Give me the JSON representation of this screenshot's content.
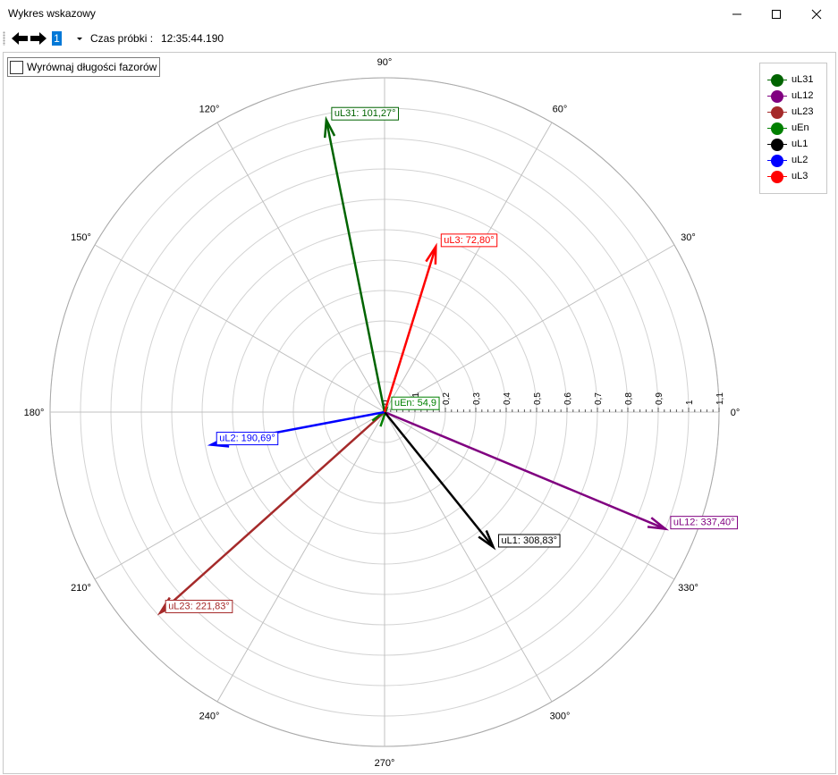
{
  "window": {
    "title": "Wykres wskazowy"
  },
  "toolbar": {
    "sample_number": "1",
    "time_label": "Czas próbki :",
    "time_value": "12:35:44.190"
  },
  "options": {
    "equalize_label": "Wyrównaj długości fazorów",
    "equalize_checked": false
  },
  "chart_data": {
    "type": "polar",
    "angle_labels": [
      "0°",
      "30°",
      "60°",
      "90°",
      "120°",
      "150°",
      "180°",
      "210°",
      "240°",
      "270°",
      "300°",
      "330°"
    ],
    "radial_ticks": [
      "0",
      "0,1",
      "0,2",
      "0,3",
      "0,4",
      "0,5",
      "0,6",
      "0,7",
      "0,8",
      "0,9",
      "1",
      "1,1"
    ],
    "rmax": 1.1,
    "grid": true,
    "legend_position": "top-right",
    "phasors": [
      {
        "name": "uL31",
        "label": "uL31: 101,27°",
        "angle": 101.27,
        "magnitude": 0.98,
        "color": "#006400"
      },
      {
        "name": "uL12",
        "label": "uL12: 337,40°",
        "angle": 337.4,
        "magnitude": 1.0,
        "color": "#800080"
      },
      {
        "name": "uL23",
        "label": "uL23: 221,83°",
        "angle": 221.83,
        "magnitude": 0.99,
        "color": "#a52a2a"
      },
      {
        "name": "uEn",
        "label": "uEn: 54,9",
        "angle": 54.9,
        "magnitude": 0.01,
        "color": "#008000"
      },
      {
        "name": "uL1",
        "label": "uL1: 308,83°",
        "angle": 308.83,
        "magnitude": 0.57,
        "color": "#000000"
      },
      {
        "name": "uL2",
        "label": "uL2: 190,69°",
        "angle": 190.69,
        "magnitude": 0.58,
        "color": "#0000ff"
      },
      {
        "name": "uL3",
        "label": "uL3: 72,80°",
        "angle": 72.8,
        "magnitude": 0.57,
        "color": "#ff0000"
      }
    ],
    "legend": [
      {
        "name": "uL31",
        "color": "#006400"
      },
      {
        "name": "uL12",
        "color": "#800080"
      },
      {
        "name": "uL23",
        "color": "#a52a2a"
      },
      {
        "name": "uEn",
        "color": "#008000"
      },
      {
        "name": "uL1",
        "color": "#000000"
      },
      {
        "name": "uL2",
        "color": "#0000ff"
      },
      {
        "name": "uL3",
        "color": "#ff0000"
      }
    ]
  }
}
